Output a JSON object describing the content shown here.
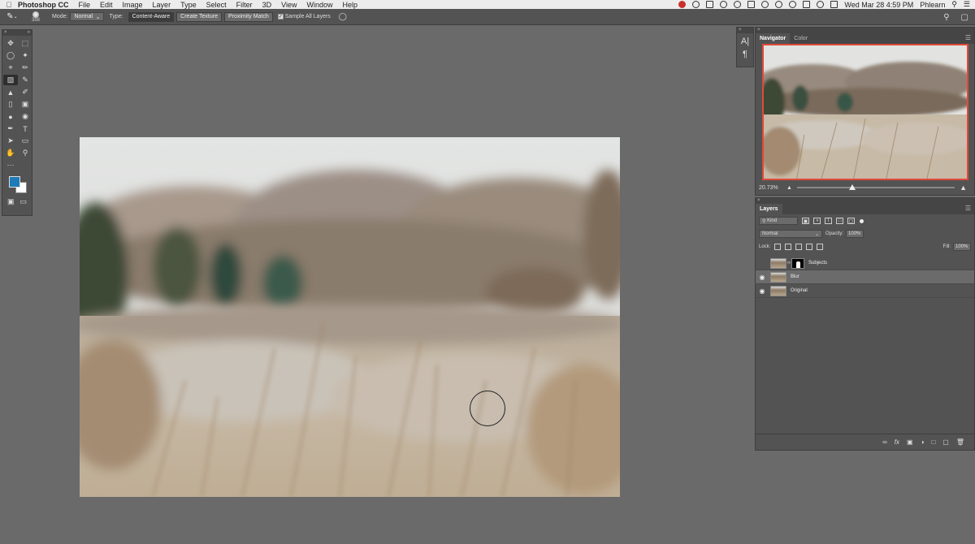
{
  "menubar": {
    "app_name": "Photoshop CC",
    "items": [
      "File",
      "Edit",
      "Image",
      "Layer",
      "Type",
      "Select",
      "Filter",
      "3D",
      "View",
      "Window",
      "Help"
    ],
    "clock": "Wed Mar 28  4:59 PM",
    "user": "Phlearn"
  },
  "options": {
    "brush_size": "388",
    "mode_label": "Mode:",
    "mode_value": "Normal",
    "type_label": "Type:",
    "type_options": [
      "Content-Aware",
      "Create Texture",
      "Proximity Match"
    ],
    "sample_all_label": "Sample All Layers",
    "sample_all_checked": true
  },
  "navigator": {
    "tabs": [
      "Navigator",
      "Color"
    ],
    "zoom": "20.73%",
    "zoom_slider_fraction": 0.35
  },
  "layers_panel": {
    "tab": "Layers",
    "filter_kind": "Kind",
    "blend_mode": "Normal",
    "opacity_label": "Opacity:",
    "opacity_value": "100%",
    "lock_label": "Lock:",
    "fill_label": "Fill:",
    "fill_value": "100%",
    "layers": [
      {
        "name": "Subjects",
        "visible": false,
        "selected": false,
        "has_mask": true
      },
      {
        "name": "Blur",
        "visible": true,
        "selected": true,
        "has_mask": false
      },
      {
        "name": "Original",
        "visible": true,
        "selected": false,
        "has_mask": false
      }
    ]
  },
  "colors": {
    "foreground": "#1e7ab8",
    "background": "#ffffff",
    "navigator_frame": "#e0493a"
  }
}
